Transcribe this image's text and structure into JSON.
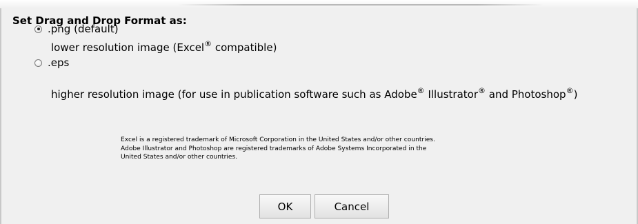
{
  "heading": "Set Drag and Drop Format as:",
  "options": [
    {
      "label": ".png (default)",
      "selected": true,
      "description": {
        "parts": [
          "lower resolution image (Excel",
          "®",
          " compatible)"
        ]
      }
    },
    {
      "label": ".eps",
      "selected": false,
      "description": {
        "parts": [
          "higher resolution image (for use in publication software such as Adobe",
          "®",
          " Illustrator",
          "®",
          " and Photoshop",
          "®",
          ")"
        ]
      }
    }
  ],
  "trademark_notice": {
    "lines": [
      "Excel is a registered trademark of Microsoft Corporation in the United States and/or other countries.",
      "Adobe Illustrator and Photoshop are registered trademarks of Adobe Systems Incorporated in the",
      "United States and/or other countries."
    ]
  },
  "buttons": {
    "ok": "OK",
    "cancel": "Cancel"
  }
}
